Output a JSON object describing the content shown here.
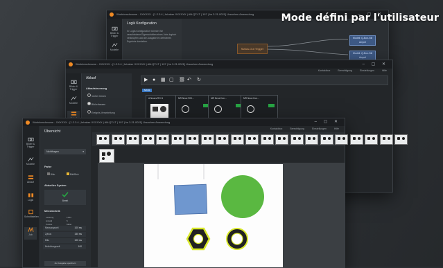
{
  "headline": "Mode défini par l'utilisateur",
  "windows": {
    "back": {
      "title": "Workbenchname - XXXXXX - [1.2.3.4 | Inhaber XXXXXX | AN:QT:LT | 197 | fw 3.21.0021] Ursachen Anwendung",
      "panel_title": "Logik Konfiguration",
      "panel_text": "In 'Logik-Konfiguration' können Sie verschiedene Eigenschaften eines Jobs logisch verknüpfen und die Ausgabe im definierten Ergebnis darstellen.",
      "rail": [
        "Bilder & Trigger",
        "Modelle"
      ],
      "node_orange": "Status-Out Trigger",
      "node_blue_1": "Modell: Q-Box-Stil Ampel",
      "node_blue_2": "Modell: Q-Box-Stil Ampel"
    },
    "middle": {
      "title": "Workbenchname - XXXXXX - [1.2.3.4 | Inhaber XXXXXX | AN:QT:LT | 197 | fw 3.21.0021] Ursachen Anwendung",
      "menu": [
        "Kontaktbox",
        "Berechtigung",
        "Einstellungen",
        "Hilfe"
      ],
      "panel_title": "Ablauf",
      "section": "Ablaufsteuerung",
      "options": [
        "Vorher lernen",
        "Bild erfassen",
        "Ereignis-Verarbeitung"
      ],
      "rail": [
        "Bilder & Trigger",
        "Modelle",
        "Ablauf"
      ],
      "tab": "Schritt",
      "cards": [
        {
          "title": "A  Neues ROI 1",
          "label": "Blob"
        },
        {
          "title": "MR Neue ROI...",
          "label": "Blob"
        },
        {
          "title": "MR Neue Kon...",
          "label": "Blob"
        },
        {
          "title": "MR Neue Kon...",
          "label": "Blob"
        }
      ]
    },
    "front": {
      "title": "Workbenchname - XXXXXX - [1.2.3.4 | Inhaber XXXXXX | AN:QT:LT | 197 | fw 3.21.0021] Ursachen Anwendung",
      "menu": [
        "Kontaktbox",
        "Berechtigung",
        "Einstellungen",
        "Hilfe"
      ],
      "panel_title": "Übersicht",
      "dropdown": "Nichtfragen",
      "rail": [
        "Bilder & Trigger",
        "Modelle",
        "Ablauf",
        "Logik",
        "Schnittstellen",
        "Job"
      ],
      "sections": {
        "farbe": "Farbe",
        "aktuelles_system": "Aktuelles System",
        "messtechnik": "Messtechnik"
      },
      "farbe_options": [
        "Blob",
        "Bild/Blob"
      ],
      "system_ok": "Bereit",
      "mess_rows": [
        {
          "label": "Leistung",
          "value": "1234"
        },
        {
          "label": "Anzahl",
          "value": "5"
        },
        {
          "label": "Punkte",
          "value": "Mittel"
        }
      ],
      "stat_rows": [
        {
          "label": "Messungszeit",
          "value": "100 ms"
        },
        {
          "label": "Zyklus",
          "value": "150 ms"
        },
        {
          "label": "Blitz",
          "value": "100 ms"
        },
        {
          "label": "Belichtungszeit",
          "value": "100"
        }
      ],
      "footer_button": "Zur Ausgabe speichern",
      "thumb_count": 21
    }
  },
  "colors": {
    "accent": "#f08a24",
    "ok_green": "#27a343",
    "shape_blue": "#6f97cf",
    "shape_green": "#5ab841",
    "nut_yellow": "#d9e92b"
  }
}
